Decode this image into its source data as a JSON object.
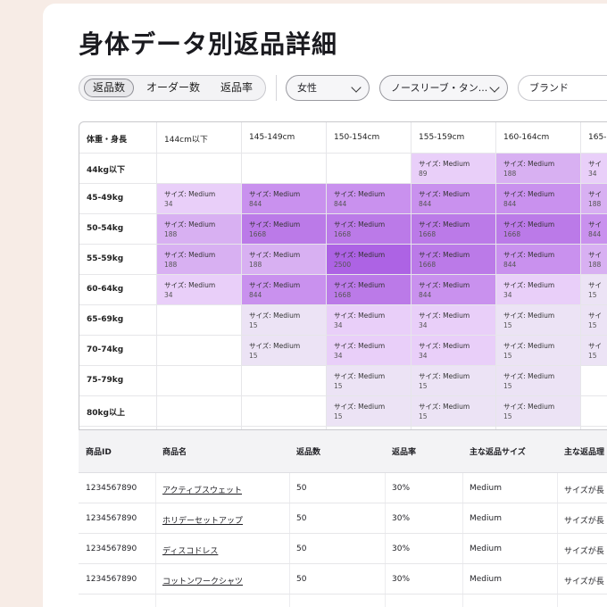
{
  "page_title": "身体データ別返品詳細",
  "segment": {
    "items": [
      "返品数",
      "オーダー数",
      "返品率"
    ],
    "active_index": 0
  },
  "filters": {
    "gender": "女性",
    "category": "ノースリーブ・タン...",
    "brand": "ブランド"
  },
  "matrix": {
    "corner_label": "体重・身長",
    "columns": [
      "144cm以下",
      "145-149cm",
      "150-154cm",
      "155-159cm",
      "160-164cm",
      "165-"
    ],
    "rows": [
      {
        "label": "44kg以下",
        "cells": [
          null,
          null,
          null,
          {
            "size": "サイズ: Medium",
            "count": "89",
            "level": 1
          },
          {
            "size": "サイズ: Medium",
            "count": "188",
            "level": 2
          },
          {
            "size": "サイ",
            "count": "34",
            "level": 1
          }
        ]
      },
      {
        "label": "45-49kg",
        "cells": [
          {
            "size": "サイズ: Medium",
            "count": "34",
            "level": 1
          },
          {
            "size": "サイズ: Medium",
            "count": "844",
            "level": 3
          },
          {
            "size": "サイズ: Medium",
            "count": "844",
            "level": 3
          },
          {
            "size": "サイズ: Medium",
            "count": "844",
            "level": 3
          },
          {
            "size": "サイズ: Medium",
            "count": "844",
            "level": 3
          },
          {
            "size": "サイ",
            "count": "188",
            "level": 2
          }
        ]
      },
      {
        "label": "50-54kg",
        "cells": [
          {
            "size": "サイズ: Medium",
            "count": "188",
            "level": 2
          },
          {
            "size": "サイズ: Medium",
            "count": "1668",
            "level": 4
          },
          {
            "size": "サイズ: Medium",
            "count": "1668",
            "level": 4
          },
          {
            "size": "サイズ: Medium",
            "count": "1668",
            "level": 4
          },
          {
            "size": "サイズ: Medium",
            "count": "1668",
            "level": 4
          },
          {
            "size": "サイ",
            "count": "844",
            "level": 3
          }
        ]
      },
      {
        "label": "55-59kg",
        "cells": [
          {
            "size": "サイズ: Medium",
            "count": "188",
            "level": 2
          },
          {
            "size": "サイズ: Medium",
            "count": "188",
            "level": 2
          },
          {
            "size": "サイズ: Medium",
            "count": "2500",
            "level": 5
          },
          {
            "size": "サイズ: Medium",
            "count": "1668",
            "level": 4
          },
          {
            "size": "サイズ: Medium",
            "count": "844",
            "level": 3
          },
          {
            "size": "サイ",
            "count": "188",
            "level": 2
          }
        ]
      },
      {
        "label": "60-64kg",
        "cells": [
          {
            "size": "サイズ: Medium",
            "count": "34",
            "level": 1
          },
          {
            "size": "サイズ: Medium",
            "count": "844",
            "level": 3
          },
          {
            "size": "サイズ: Medium",
            "count": "1668",
            "level": 4
          },
          {
            "size": "サイズ: Medium",
            "count": "844",
            "level": 3
          },
          {
            "size": "サイズ: Medium",
            "count": "34",
            "level": 1
          },
          {
            "size": "サイ",
            "count": "15",
            "level": 0
          }
        ]
      },
      {
        "label": "65-69kg",
        "cells": [
          null,
          {
            "size": "サイズ: Medium",
            "count": "15",
            "level": 0
          },
          {
            "size": "サイズ: Medium",
            "count": "34",
            "level": 1
          },
          {
            "size": "サイズ: Medium",
            "count": "34",
            "level": 1
          },
          {
            "size": "サイズ: Medium",
            "count": "15",
            "level": 0
          },
          {
            "size": "サイ",
            "count": "15",
            "level": 0
          }
        ]
      },
      {
        "label": "70-74kg",
        "cells": [
          null,
          {
            "size": "サイズ: Medium",
            "count": "15",
            "level": 0
          },
          {
            "size": "サイズ: Medium",
            "count": "34",
            "level": 1
          },
          {
            "size": "サイズ: Medium",
            "count": "34",
            "level": 1
          },
          {
            "size": "サイズ: Medium",
            "count": "15",
            "level": 0
          },
          {
            "size": "サイ",
            "count": "15",
            "level": 0
          }
        ]
      },
      {
        "label": "75-79kg",
        "cells": [
          null,
          null,
          {
            "size": "サイズ: Medium",
            "count": "15",
            "level": 0
          },
          {
            "size": "サイズ: Medium",
            "count": "15",
            "level": 0
          },
          {
            "size": "サイズ: Medium",
            "count": "15",
            "level": 0
          },
          null
        ]
      },
      {
        "label": "80kg以上",
        "cells": [
          null,
          null,
          {
            "size": "サイズ: Medium",
            "count": "15",
            "level": 0
          },
          {
            "size": "サイズ: Medium",
            "count": "15",
            "level": 0
          },
          {
            "size": "サイズ: Medium",
            "count": "15",
            "level": 0
          },
          null
        ]
      }
    ],
    "level_colors": [
      "#ece3f5",
      "#e9cff9",
      "#d8b0f2",
      "#c991ee",
      "#bb7ae8",
      "#ad63e4"
    ]
  },
  "table": {
    "headers": [
      "商品ID",
      "商品名",
      "返品数",
      "返品率",
      "主な返品サイズ",
      "主な返品理"
    ],
    "rows": [
      [
        "1234567890",
        "アクティブスウェット",
        "50",
        "30%",
        "Medium",
        "サイズが長"
      ],
      [
        "1234567890",
        "ホリデーセットアップ",
        "50",
        "30%",
        "Medium",
        "サイズが長"
      ],
      [
        "1234567890",
        "ディスコドレス",
        "50",
        "30%",
        "Medium",
        "サイズが長"
      ],
      [
        "1234567890",
        "コットンワークシャツ",
        "50",
        "30%",
        "Medium",
        "サイズが長"
      ]
    ]
  }
}
